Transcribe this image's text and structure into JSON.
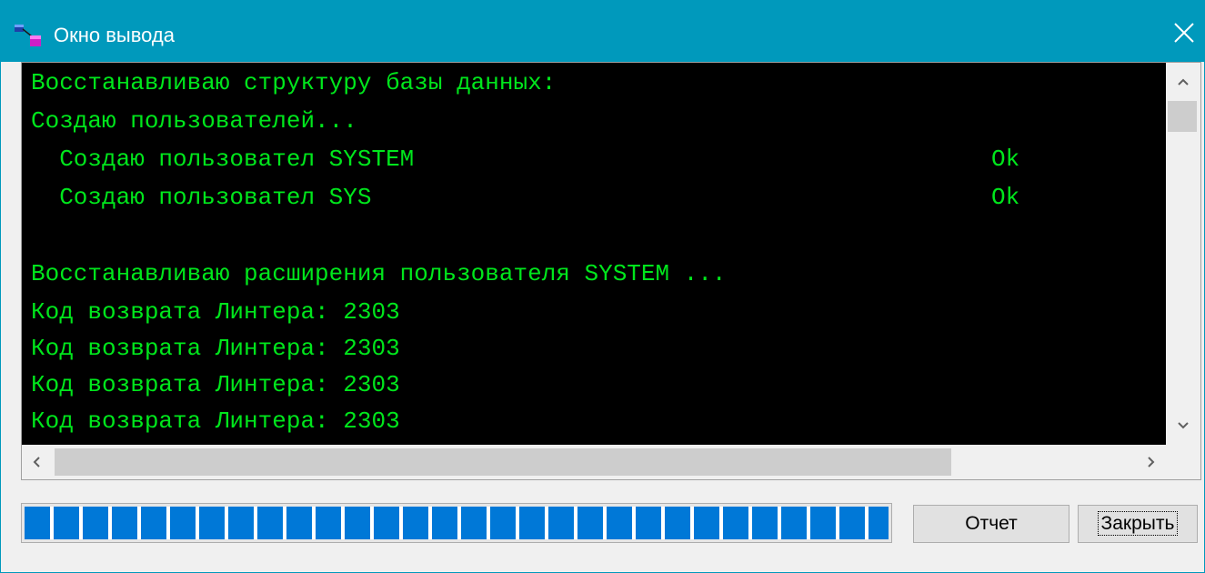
{
  "window": {
    "title": "Окно вывода",
    "accent_color": "#0099bc",
    "icons": {
      "app": "database-app-icon",
      "close": "close-icon"
    }
  },
  "console": {
    "text_color": "#00e61c",
    "background": "#000000",
    "lines": [
      {
        "text": "Восстанавливаю структуру базы данных:",
        "status": ""
      },
      {
        "text": "Создаю пользователей...",
        "status": ""
      },
      {
        "text": "  Создаю пользовател SYSTEM",
        "status": "Ok"
      },
      {
        "text": "  Создаю пользовател SYS",
        "status": "Ok"
      },
      {
        "text": "",
        "status": ""
      },
      {
        "text": "Восстанавливаю расширения пользователя SYSTEM ...",
        "status": ""
      },
      {
        "text": "Код возврата Линтера: 2303",
        "status": ""
      },
      {
        "text": "Код возврата Линтера: 2303",
        "status": ""
      },
      {
        "text": "Код возврата Линтера: 2303",
        "status": ""
      },
      {
        "text": "Код возврата Линтера: 2303",
        "status": ""
      }
    ]
  },
  "progress": {
    "value": 1.0,
    "color": "#0078d7"
  },
  "buttons": {
    "report_label": "Отчет",
    "close_label": "Закрыть"
  }
}
